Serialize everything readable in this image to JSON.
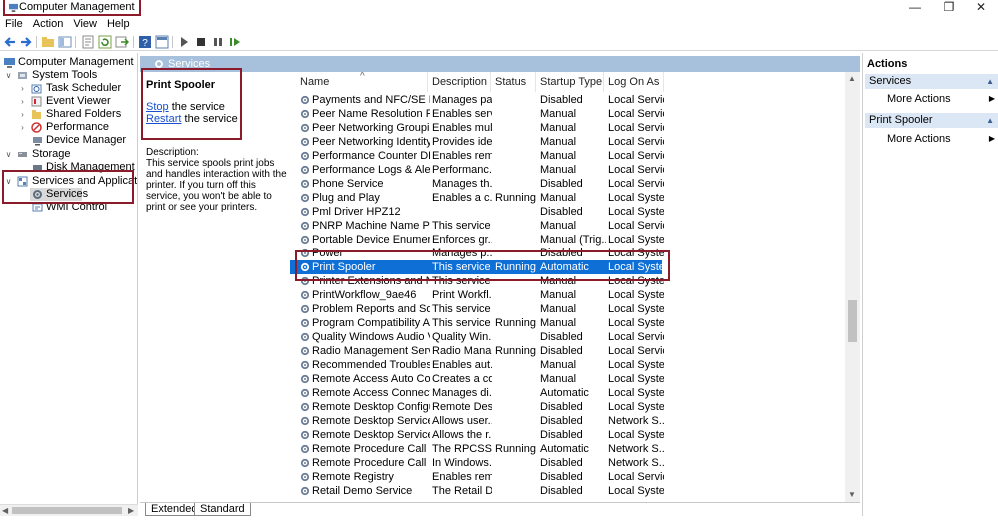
{
  "window": {
    "title": "Computer Management",
    "minimize_glyph": "—",
    "maximize_glyph": "❐",
    "close_glyph": "✕"
  },
  "menu": [
    "File",
    "Action",
    "View",
    "Help"
  ],
  "tree": {
    "root": "Computer Management (Local",
    "system_tools": "System Tools",
    "task_scheduler": "Task Scheduler",
    "event_viewer": "Event Viewer",
    "shared_folders": "Shared Folders",
    "performance": "Performance",
    "device_manager": "Device Manager",
    "storage": "Storage",
    "disk_management": "Disk Management",
    "services_and_applications": "Services and Applications",
    "services": "Services",
    "wmi_control": "WMI Control"
  },
  "center": {
    "header": "Services",
    "detail": {
      "title": "Print Spooler",
      "stop_link": "Stop",
      "stop_rest": " the service",
      "restart_link": "Restart",
      "restart_rest": " the service",
      "description_label": "Description:",
      "description": "This service spools print jobs and handles interaction with the printer. If you turn off this service, you won't be able to print or see your printers."
    },
    "columns": [
      "Name",
      "Description",
      "Status",
      "Startup Type",
      "Log On As"
    ],
    "sort_glyph": "^",
    "rows": [
      [
        "Payments and NFC/SE Man...",
        "Manages pa...",
        "",
        "Disabled",
        "Local Service"
      ],
      [
        "Peer Name Resolution Prot...",
        "Enables serv...",
        "",
        "Manual",
        "Local Service"
      ],
      [
        "Peer Networking Grouping",
        "Enables mul...",
        "",
        "Manual",
        "Local Service"
      ],
      [
        "Peer Networking Identity M...",
        "Provides ide...",
        "",
        "Manual",
        "Local Service"
      ],
      [
        "Performance Counter DLL ...",
        "Enables rem...",
        "",
        "Manual",
        "Local Service"
      ],
      [
        "Performance Logs & Alerts",
        "Performanc...",
        "",
        "Manual",
        "Local Service"
      ],
      [
        "Phone Service",
        "Manages th...",
        "",
        "Disabled",
        "Local Service"
      ],
      [
        "Plug and Play",
        "Enables a c...",
        "Running",
        "Manual",
        "Local Syste..."
      ],
      [
        "Pml Driver HPZ12",
        "",
        "",
        "Disabled",
        "Local Syste..."
      ],
      [
        "PNRP Machine Name Publi...",
        "This service ...",
        "",
        "Manual",
        "Local Service"
      ],
      [
        "Portable Device Enumerator...",
        "Enforces gr...",
        "",
        "Manual (Trig...",
        "Local Syste..."
      ],
      [
        "Power",
        "Manages p...",
        "",
        "Disabled",
        "Local Syste..."
      ],
      [
        "Print Spooler",
        "This service ...",
        "Running",
        "Automatic",
        "Local Syste..."
      ],
      [
        "Printer Extensions and Notif...",
        "This service ...",
        "",
        "Manual",
        "Local Syste..."
      ],
      [
        "PrintWorkflow_9ae46",
        "Print Workfl...",
        "",
        "Manual",
        "Local Syste..."
      ],
      [
        "Problem Reports and Soluti...",
        "This service ...",
        "",
        "Manual",
        "Local Syste..."
      ],
      [
        "Program Compatibility Assi...",
        "This service ...",
        "Running",
        "Manual",
        "Local Syste..."
      ],
      [
        "Quality Windows Audio Vid...",
        "Quality Win...",
        "",
        "Disabled",
        "Local Service"
      ],
      [
        "Radio Management Service",
        "Radio Mana...",
        "Running",
        "Disabled",
        "Local Service"
      ],
      [
        "Recommended Troublesho...",
        "Enables aut...",
        "",
        "Manual",
        "Local Syste..."
      ],
      [
        "Remote Access Auto Conne...",
        "Creates a co...",
        "",
        "Manual",
        "Local Syste..."
      ],
      [
        "Remote Access Connection...",
        "Manages di...",
        "",
        "Automatic",
        "Local Syste..."
      ],
      [
        "Remote Desktop Configurat...",
        "Remote Des...",
        "",
        "Disabled",
        "Local Syste..."
      ],
      [
        "Remote Desktop Services",
        "Allows user...",
        "",
        "Disabled",
        "Network S..."
      ],
      [
        "Remote Desktop Services U...",
        "Allows the r...",
        "",
        "Disabled",
        "Local Syste..."
      ],
      [
        "Remote Procedure Call (RPC)",
        "The RPCSS s...",
        "Running",
        "Automatic",
        "Network S..."
      ],
      [
        "Remote Procedure Call (RP...",
        "In Windows...",
        "",
        "Disabled",
        "Network S..."
      ],
      [
        "Remote Registry",
        "Enables rem...",
        "",
        "Disabled",
        "Local Service"
      ],
      [
        "Retail Demo Service",
        "The Retail D...",
        "",
        "Disabled",
        "Local Syste..."
      ]
    ],
    "selected_row": 12,
    "tabs": [
      "Extended",
      "Standard"
    ]
  },
  "actions": {
    "title": "Actions",
    "group1": "Services",
    "group1_item": "More Actions",
    "group2": "Print Spooler",
    "group2_item": "More Actions"
  },
  "colors": {
    "accent_red": "#8b1a2b",
    "selection": "#0e6fd6",
    "header_blue": "#a7c1dc",
    "link": "#1a4fd0"
  }
}
